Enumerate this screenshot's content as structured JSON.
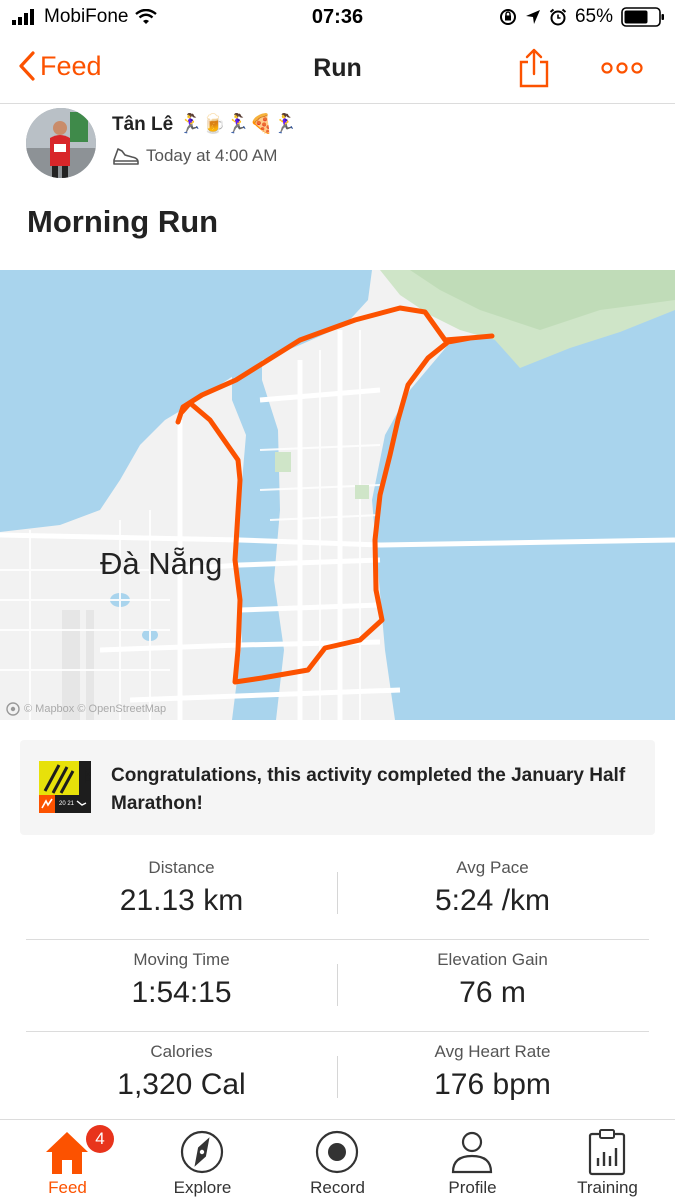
{
  "status_bar": {
    "carrier": "MobiFone",
    "time": "07:36",
    "battery": "65%"
  },
  "nav": {
    "back_label": "Feed",
    "title": "Run"
  },
  "athlete": {
    "name": "Tân Lê 🏃‍♀️🍺🏃‍♀️🍕🏃‍♀️",
    "date": "Today at 4:00 AM"
  },
  "activity": {
    "title": "Morning Run"
  },
  "map": {
    "city_label": "Đà Nẵng",
    "attribution": "© Mapbox © OpenStreetMap",
    "route_color": "#fc5200"
  },
  "challenge": {
    "text": "Congratulations, this activity completed the January Half Marathon!",
    "badge_top": "13.1",
    "badge_year": "20 21"
  },
  "stats": [
    {
      "left": {
        "label": "Distance",
        "value": "21.13 km"
      },
      "right": {
        "label": "Avg Pace",
        "value": "5:24 /km"
      }
    },
    {
      "left": {
        "label": "Moving Time",
        "value": "1:54:15"
      },
      "right": {
        "label": "Elevation Gain",
        "value": "76 m"
      }
    },
    {
      "left": {
        "label": "Calories",
        "value": "1,320 Cal"
      },
      "right": {
        "label": "Avg Heart Rate",
        "value": "176 bpm"
      }
    }
  ],
  "tabs": [
    {
      "label": "Feed",
      "badge": "4"
    },
    {
      "label": "Explore"
    },
    {
      "label": "Record"
    },
    {
      "label": "Profile"
    },
    {
      "label": "Training"
    }
  ],
  "colors": {
    "accent": "#fc5200",
    "water": "#a9d4ed",
    "land": "#f2f2f2",
    "park": "#cfe5c8"
  }
}
